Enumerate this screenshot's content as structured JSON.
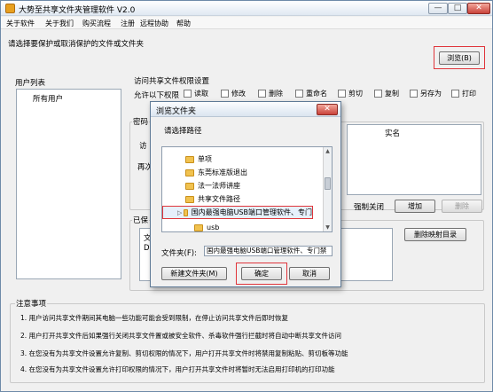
{
  "window": {
    "title": "大势至共享文件夹管理软件 V2.0",
    "min_glyph": "—",
    "max_glyph": "□",
    "close_glyph": "✕"
  },
  "menu": [
    "关于软件",
    "关于我们",
    "购买流程",
    "注册",
    "远程协助",
    "帮助"
  ],
  "main": {
    "select_prompt": "请选择要保护或取消保护的文件或文件夹",
    "browse_button": "浏览(B)",
    "user_list_title": "用户列表",
    "user_list_items": [
      "所有用户"
    ],
    "permission_title": "访问共享文件权限设置",
    "allow_label": "允许以下权限",
    "permissions": [
      "读取",
      "修改",
      "删除",
      "重命名",
      "剪切",
      "复制",
      "另存为",
      "打印"
    ],
    "password_label": "密码",
    "visit_label": "访",
    "again_label": "再次",
    "column_header": "实名",
    "force_close_label": "强制关闭",
    "add_button": "增加",
    "delete_button": "删除",
    "protected_label": "已保",
    "file_col_label": "文",
    "drive_label": "D:",
    "remove_map_button": "删除映射目录"
  },
  "notes": {
    "title": "注意事项",
    "items": [
      "1. 用户访问共享文件期间其电脑一些功能可能会受到限制，在停止访问共享文件后即时恢复",
      "2. 用户打开共享文件后如果强行关闭共享文件置或被安全软件、杀毒软件强行拦截时将自动中断共享文件访问",
      "3. 在您没有为共享文件设置允许复制、剪切权限的情况下，用户打开共享文件时将禁用复制粘贴、剪切板等功能",
      "4. 在您没有为共享文件设置允许打印权限的情况下，用户打开共享文件时将暂时无法启用打印机的打印功能"
    ]
  },
  "dialog": {
    "title": "浏览文件夹",
    "close_glyph": "✕",
    "prompt": "请选择路径",
    "tree": [
      {
        "label": "单项",
        "selected": false
      },
      {
        "label": "东莞标准版退出",
        "selected": false
      },
      {
        "label": "法一法师讲座",
        "selected": false
      },
      {
        "label": "共享文件路径",
        "selected": false
      },
      {
        "label": "国内最强电脑USB端口管理软件、专门",
        "selected": true
      },
      {
        "label": "usb",
        "selected": false
      }
    ],
    "folder_label": "文件夹(F):",
    "folder_value": "国内最强电脑USB端口管理软件、专门禁",
    "new_folder_button": "新建文件夹(M)",
    "ok_button": "确定",
    "cancel_button": "取消"
  }
}
